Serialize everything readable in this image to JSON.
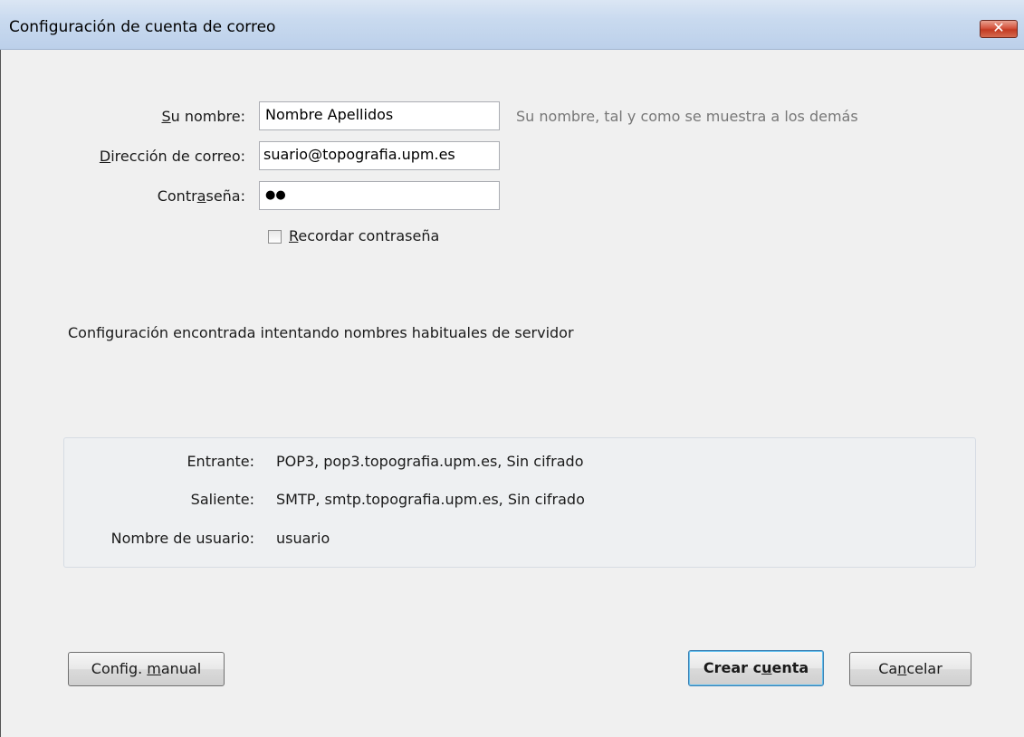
{
  "window": {
    "title": "Configuración de cuenta de correo",
    "close_glyph": "✕"
  },
  "form": {
    "name": {
      "label_underlined": "S",
      "label_rest": "u nombre:",
      "value": "Nombre Apellidos",
      "hint": "Su nombre, tal y como se muestra a los demás"
    },
    "email": {
      "label_underlined": "D",
      "label_rest": "irección de correo:",
      "value": "suario@topografia.upm.es"
    },
    "password": {
      "label_pre": "Contr",
      "label_underlined": "a",
      "label_rest": "seña:",
      "value": "●●"
    },
    "remember": {
      "label_underlined": "R",
      "label_rest": "ecordar contraseña",
      "checked": false
    }
  },
  "status": "Configuración encontrada intentando nombres habituales de servidor",
  "server": {
    "incoming": {
      "label": "Entrante:",
      "value": "POP3, pop3.topografia.upm.es, Sin cifrado"
    },
    "outgoing": {
      "label": "Saliente:",
      "value": "SMTP, smtp.topografia.upm.es, Sin cifrado"
    },
    "username": {
      "label": "Nombre de usuario:",
      "value": "usuario"
    }
  },
  "buttons": {
    "manual": {
      "pre": "Config. ",
      "underlined": "m",
      "rest": "anual"
    },
    "create": {
      "pre": "Crear c",
      "underlined": "u",
      "rest": "enta"
    },
    "cancel": {
      "pre": "Ca",
      "underlined": "n",
      "rest": "celar"
    }
  },
  "colors": {
    "titlebar": "#c9daef",
    "close_button": "#c94a32",
    "default_button_border": "#3c7fb1"
  }
}
